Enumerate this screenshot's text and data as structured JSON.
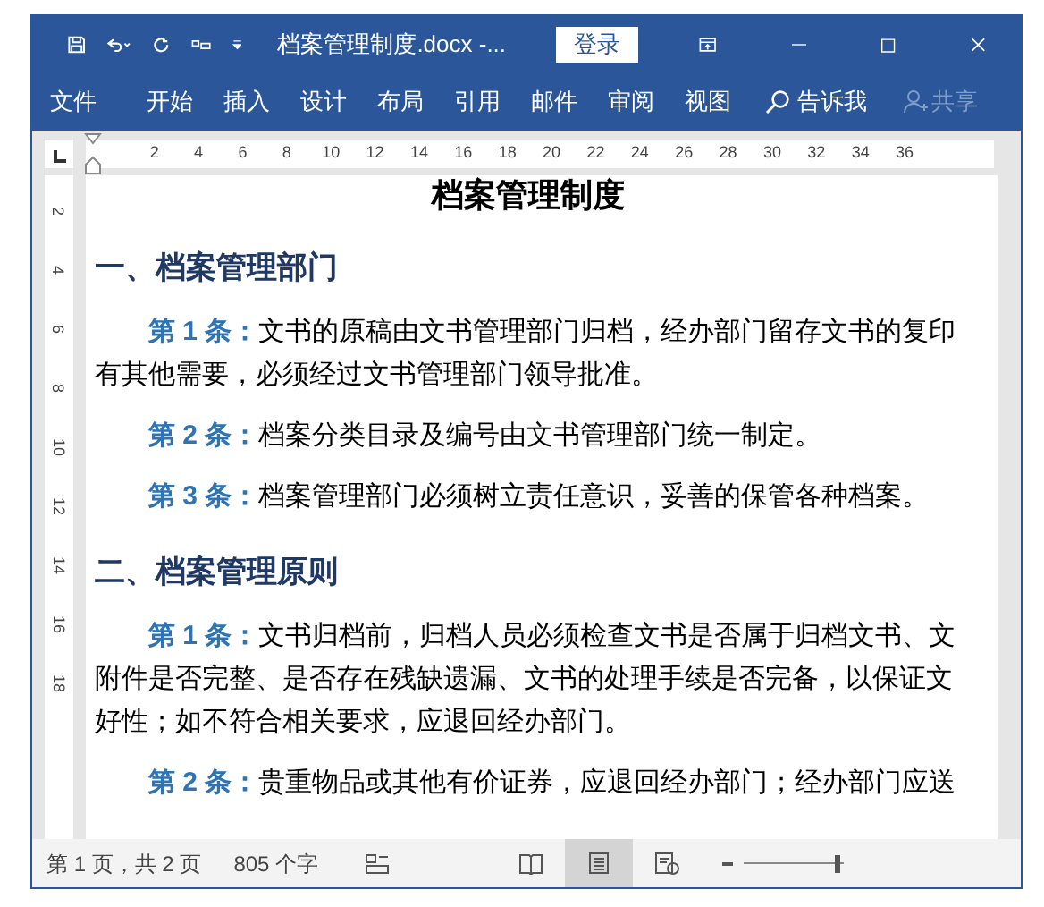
{
  "title_bar": {
    "title": "档案管理制度.docx -...",
    "login_button": "登录"
  },
  "ribbon_tabs": [
    {
      "label": "文件",
      "selected": false
    },
    {
      "label": "开始",
      "selected": false
    },
    {
      "label": "插入",
      "selected": false
    },
    {
      "label": "设计",
      "selected": false
    },
    {
      "label": "布局",
      "selected": false
    },
    {
      "label": "引用",
      "selected": false
    },
    {
      "label": "邮件",
      "selected": false
    },
    {
      "label": "审阅",
      "selected": false
    },
    {
      "label": "视图",
      "selected": false
    }
  ],
  "tell_me": "告诉我",
  "share": {
    "label": "共享",
    "disabled": true
  },
  "horizontal_ruler": [
    "2",
    "4",
    "6",
    "8",
    "10",
    "12",
    "14",
    "16",
    "18",
    "20",
    "22",
    "24",
    "26",
    "28",
    "30",
    "32",
    "34",
    "36"
  ],
  "vertical_ruler": [
    "2",
    "4",
    "6",
    "8",
    "10",
    "12",
    "14",
    "16",
    "18"
  ],
  "document": {
    "title": "档案管理制度",
    "blocks": [
      {
        "kind": "heading",
        "text": "一、档案管理部门"
      },
      {
        "kind": "article",
        "label": "第 1 条：",
        "lines": [
          "文书的原稿由文书管理部门归档，经办部门留存文书的复印",
          "有其他需要，必须经过文书管理部门领导批准。"
        ]
      },
      {
        "kind": "article",
        "label": "第 2 条：",
        "lines": [
          "档案分类目录及编号由文书管理部门统一制定。"
        ]
      },
      {
        "kind": "article",
        "label": "第 3 条：",
        "lines": [
          "档案管理部门必须树立责任意识，妥善的保管各种档案。"
        ]
      },
      {
        "kind": "heading",
        "text": "二、档案管理原则"
      },
      {
        "kind": "article",
        "label": "第 1 条：",
        "lines": [
          "文书归档前，归档人员必须检查文书是否属于归档文书、文",
          "附件是否完整、是否存在残缺遗漏、文书的处理手续是否完备，以保证文",
          "好性；如不符合相关要求，应退回经办部门。"
        ]
      },
      {
        "kind": "article",
        "label": "第 2 条：",
        "lines": [
          "贵重物品或其他有价证券，应退回经办部门；经办部门应送"
        ]
      }
    ]
  },
  "status_bar": {
    "page": "第 1 页，共 2 页",
    "word_count": "805 个字",
    "views": [
      {
        "kind": "read",
        "selected": false
      },
      {
        "kind": "print",
        "selected": true
      },
      {
        "kind": "web",
        "selected": false
      }
    ],
    "zoom": {
      "level": 0.93
    }
  }
}
